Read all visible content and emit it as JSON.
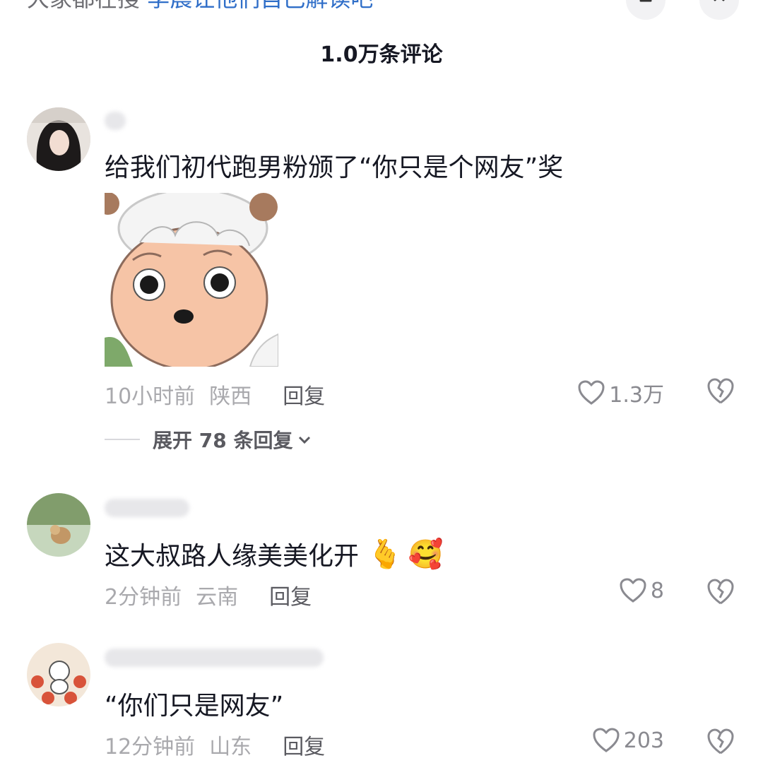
{
  "top_search": {
    "prefix": "大家都在搜·",
    "link": "李晨让他们自己解读吧",
    "icon_1": "filter-icon",
    "icon_2": "close-icon"
  },
  "header": {
    "comment_count": "1.0万条评论"
  },
  "comments": [
    {
      "text": "给我们初代跑男粉颁了“你只是个网友”奖",
      "time": "10小时前",
      "location": "陕西",
      "reply_label": "回复",
      "likes": "1.3万",
      "has_sticker": true,
      "expand_label": "展开 78 条回复"
    },
    {
      "text": "这大叔路人缘美美化开",
      "emojis": [
        "🫰",
        "🥰"
      ],
      "time": "2分钟前",
      "location": "云南",
      "reply_label": "回复",
      "likes": "8"
    },
    {
      "text": "“你们只是网友”",
      "time": "12分钟前",
      "location": "山东",
      "reply_label": "回复",
      "likes": "203"
    }
  ],
  "colors": {
    "text_primary": "#161823",
    "text_meta": "#a9a9ad",
    "link": "#2f6ec8"
  }
}
